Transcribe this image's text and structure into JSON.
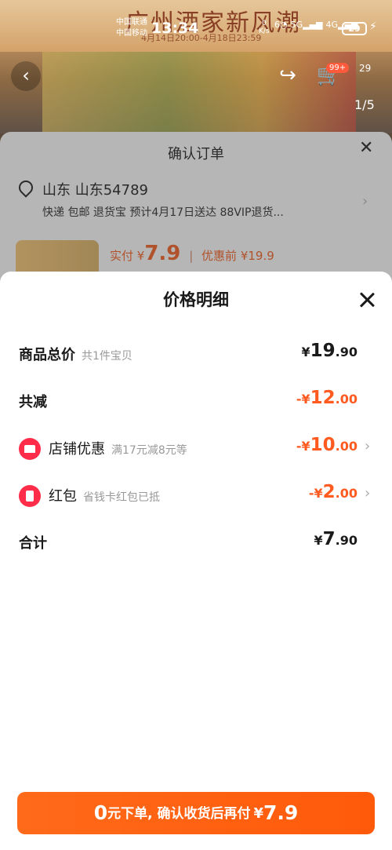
{
  "status_bar": {
    "carrier_1": "中国联通",
    "carrier_2": "中国移动",
    "time": "13:34",
    "net_speed_value": "0",
    "net_speed_unit": "K/s",
    "wifi_label": "6",
    "signal_1_label": "5G",
    "signal_2_label": "4G",
    "battery": "29"
  },
  "banner": {
    "brand": "广州酒家",
    "title": "新风潮",
    "date_range": "4月14日20:00-4月18日23:59"
  },
  "product_nav": {
    "back_icon": "chevron-left-icon",
    "cart_badge": "99+",
    "more_label": "29",
    "photo_index": "1/5"
  },
  "order_sheet": {
    "title": "确认订单",
    "address": "山东 山东54789",
    "shipping": "快递 包邮 退货宝 预计4月17日送达 88VIP退货...",
    "paid_label": "实付",
    "paid_symbol": "¥",
    "paid_amount": "7.9",
    "pre_discount_label": "优惠前",
    "pre_discount_amount": "¥19.9"
  },
  "price_detail": {
    "title": "价格明细",
    "rows": [
      {
        "label": "商品总价",
        "sub": "共1件宝贝",
        "symbol": "¥",
        "int": "19",
        "dec": ".90"
      },
      {
        "label": "共减",
        "sub": "",
        "symbol": "-¥",
        "int": "12",
        "dec": ".00"
      },
      {
        "label": "店铺优惠",
        "sub": "满17元减8元等",
        "symbol": "-¥",
        "int": "10",
        "dec": ".00"
      },
      {
        "label": "红包",
        "sub": "省钱卡红包已抵",
        "symbol": "-¥",
        "int": "2",
        "dec": ".00"
      },
      {
        "label": "合计",
        "sub": "",
        "symbol": "¥",
        "int": "7",
        "dec": ".90"
      }
    ]
  },
  "confirm_button": {
    "zero": "0",
    "text": "元下单, 确认收货后再付",
    "symbol": "¥",
    "amount": "7.9"
  },
  "colors": {
    "accent": "#ff5a1f",
    "icon_red": "#ff2d4a"
  }
}
